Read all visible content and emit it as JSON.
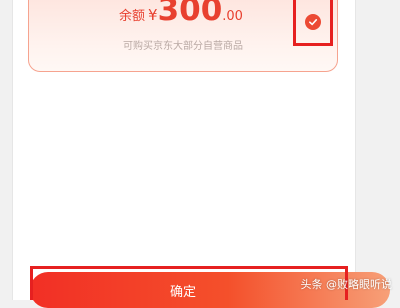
{
  "card": {
    "balance_label": "余额",
    "currency_symbol": "¥",
    "amount_integer": "300",
    "amount_decimal": ".00",
    "description": "可购买京东大部分自营商品",
    "selected": true
  },
  "footer": {
    "confirm_label": "确定"
  },
  "watermark": {
    "text": "头条 @败略眼听说"
  },
  "colors": {
    "accent": "#e8402f",
    "highlight_frame": "#e62020"
  },
  "icons": {
    "selected": "checkmark-icon"
  }
}
